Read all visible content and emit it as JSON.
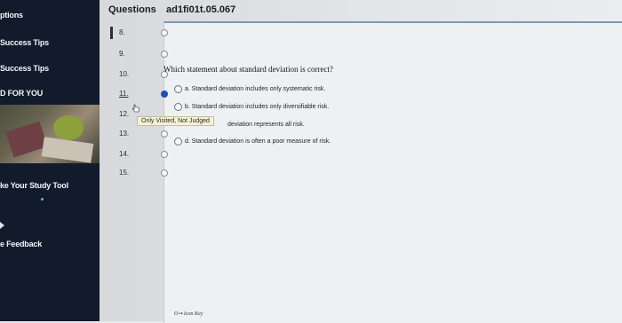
{
  "sidebar": {
    "items": [
      {
        "label": "ptions"
      },
      {
        "label": "Success Tips"
      },
      {
        "label": "Success Tips"
      },
      {
        "label": "D FOR YOU"
      },
      {
        "label": "ke Your Study Tool"
      },
      {
        "label": "e Feedback"
      }
    ]
  },
  "header": {
    "tab_label": "Questions",
    "assignment_id": "ad1fi01t.05.067"
  },
  "question_list": [
    {
      "number": "8.",
      "state": "empty"
    },
    {
      "number": "9.",
      "state": "empty"
    },
    {
      "number": "10.",
      "state": "empty"
    },
    {
      "number": "11.",
      "state": "filled"
    },
    {
      "number": "12.",
      "state": "empty"
    },
    {
      "number": "13.",
      "state": "empty"
    },
    {
      "number": "14.",
      "state": "empty"
    },
    {
      "number": "15.",
      "state": "empty"
    }
  ],
  "tooltip": "Only Visited, Not Judged",
  "question": {
    "text": "Which statement about standard deviation is correct?",
    "options": [
      {
        "label": "a. Standard deviation includes only systematic risk."
      },
      {
        "label": "b. Standard deviation includes only diversifiable risk."
      },
      {
        "label": "deviation represents all risk."
      },
      {
        "label": "d. Standard deviation is often a poor measure of risk."
      }
    ]
  },
  "footer": {
    "icon_key_label": "Icon Key"
  }
}
